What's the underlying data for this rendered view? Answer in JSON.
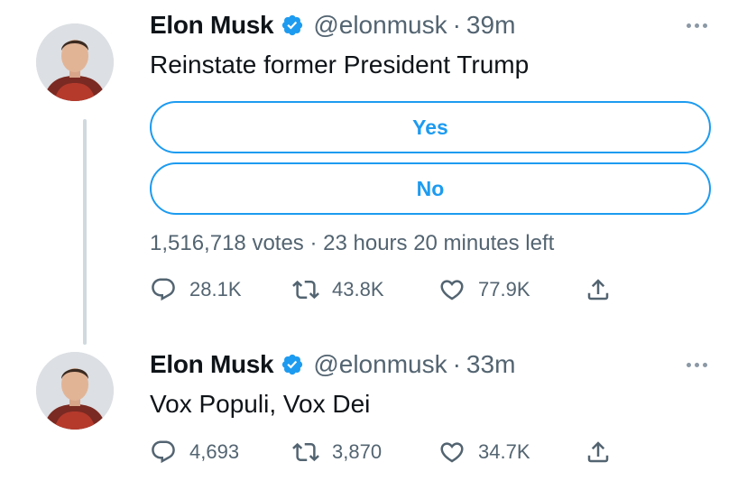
{
  "tweets": [
    {
      "name": "Elon Musk",
      "handle": "@elonmusk",
      "separator": "·",
      "time": "39m",
      "text": "Reinstate former President Trump",
      "poll": {
        "options": [
          "Yes",
          "No"
        ],
        "meta": "1,516,718 votes · 23 hours 20 minutes left"
      },
      "stats": {
        "replies": "28.1K",
        "retweets": "43.8K",
        "likes": "77.9K"
      }
    },
    {
      "name": "Elon Musk",
      "handle": "@elonmusk",
      "separator": "·",
      "time": "33m",
      "text": "Vox Populi, Vox Dei",
      "stats": {
        "replies": "4,693",
        "retweets": "3,870",
        "likes": "34.7K"
      }
    }
  ],
  "colors": {
    "accent": "#1d9bf0",
    "muted_text": "#536471",
    "thread_line": "#cfd9de"
  },
  "icons": [
    "verified-badge-icon",
    "more-icon",
    "reply-icon",
    "retweet-icon",
    "like-icon",
    "share-icon"
  ]
}
